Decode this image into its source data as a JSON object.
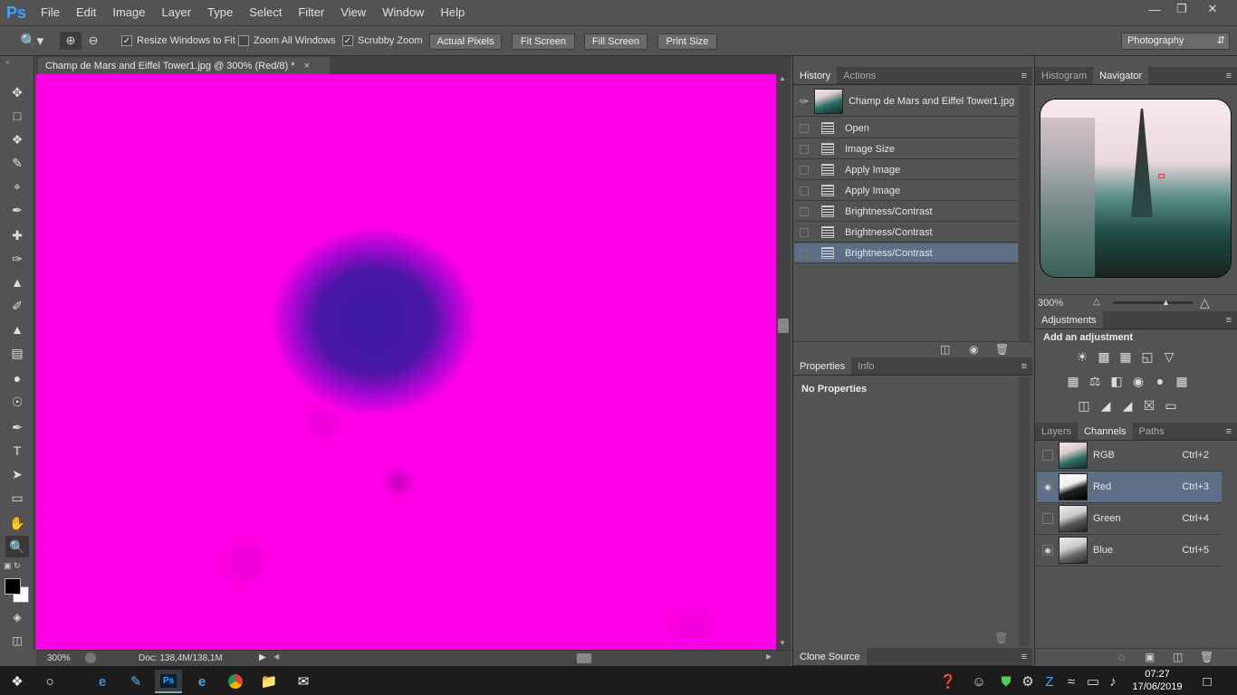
{
  "app": {
    "logo": "Ps"
  },
  "menu": [
    "File",
    "Edit",
    "Image",
    "Layer",
    "Type",
    "Select",
    "Filter",
    "View",
    "Window",
    "Help"
  ],
  "options": {
    "resize_windows": "Resize Windows to Fit",
    "zoom_all": "Zoom All Windows",
    "scrubby": "Scrubby Zoom",
    "actual_pixels": "Actual Pixels",
    "fit_screen": "Fit Screen",
    "fill_screen": "Fill Screen",
    "print_size": "Print Size",
    "workspace": "Photography"
  },
  "document": {
    "tab_title": "Champ de Mars and Eiffel Tower1.jpg @ 300% (Red/8) *",
    "zoom": "300%",
    "doc_size": "Doc: 138,4M/138,1M"
  },
  "history": {
    "tab": "History",
    "tab2": "Actions",
    "snapshot": "Champ de Mars and Eiffel Tower1.jpg",
    "items": [
      "Open",
      "Image Size",
      "Apply Image",
      "Apply Image",
      "Brightness/Contrast",
      "Brightness/Contrast",
      "Brightness/Contrast"
    ]
  },
  "properties": {
    "tab": "Properties",
    "tab2": "Info",
    "text": "No Properties"
  },
  "clone_source": "Clone Source",
  "navigator": {
    "tab": "Histogram",
    "tab2": "Navigator",
    "zoom": "300%"
  },
  "adjustments": {
    "tab": "Adjustments",
    "title": "Add an adjustment"
  },
  "channels": {
    "tab1": "Layers",
    "tab2": "Channels",
    "tab3": "Paths",
    "items": [
      {
        "name": "RGB",
        "shortcut": "Ctrl+2"
      },
      {
        "name": "Red",
        "shortcut": "Ctrl+3"
      },
      {
        "name": "Green",
        "shortcut": "Ctrl+4"
      },
      {
        "name": "Blue",
        "shortcut": "Ctrl+5"
      }
    ]
  },
  "taskbar": {
    "time": "07:27",
    "date": "17/06/2019"
  },
  "colors": {
    "canvas": "#ff00e6",
    "selected": "#5c6f87",
    "panel": "#535353"
  }
}
